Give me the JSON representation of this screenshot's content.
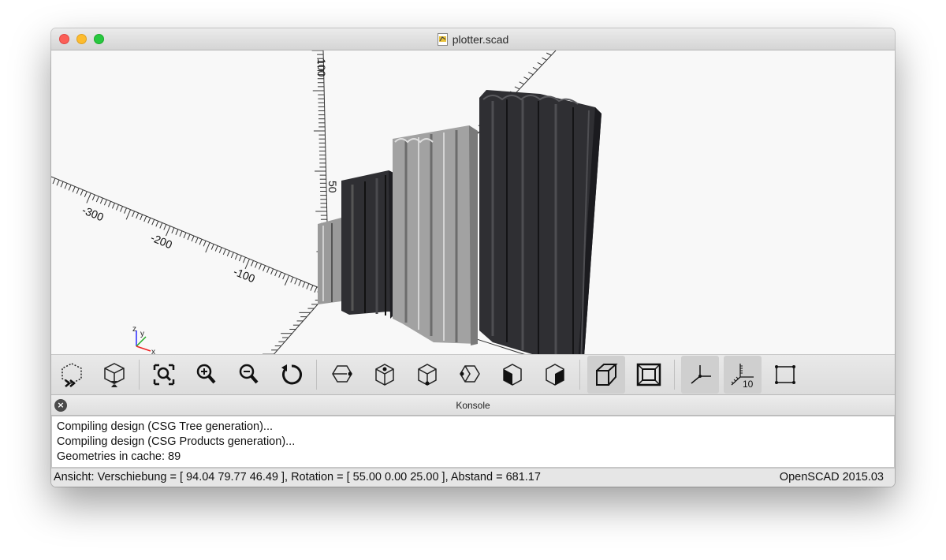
{
  "window": {
    "title": "plotter.scad"
  },
  "viewport": {
    "axis_labels": {
      "neg_300": "-300",
      "neg_200": "-200",
      "neg_100": "-100",
      "z_50": "50",
      "z_100": "100"
    },
    "gizmo": {
      "z": "z",
      "y": "y",
      "x": "x"
    }
  },
  "toolbar": {
    "buttons": [
      {
        "name": "preview",
        "icon": "preview-icon"
      },
      {
        "name": "render",
        "icon": "render-icon"
      },
      {
        "name": "view-all",
        "icon": "zoom-fit-icon"
      },
      {
        "name": "zoom-in",
        "icon": "zoom-in-icon"
      },
      {
        "name": "zoom-out",
        "icon": "zoom-out-icon"
      },
      {
        "name": "reset-view",
        "icon": "reset-view-icon"
      },
      {
        "name": "view-right",
        "icon": "view-right-icon"
      },
      {
        "name": "view-top",
        "icon": "view-top-icon"
      },
      {
        "name": "view-bottom",
        "icon": "view-bottom-icon"
      },
      {
        "name": "view-left",
        "icon": "view-left-icon"
      },
      {
        "name": "view-front",
        "icon": "view-front-icon"
      },
      {
        "name": "view-back",
        "icon": "view-back-icon"
      },
      {
        "name": "perspective",
        "icon": "perspective-icon",
        "active": true
      },
      {
        "name": "orthogonal",
        "icon": "orthogonal-icon"
      },
      {
        "name": "show-axes",
        "icon": "axes-icon",
        "active": true
      },
      {
        "name": "show-scale-markers",
        "icon": "scale-markers-icon",
        "active": true,
        "label": "10"
      },
      {
        "name": "show-edges",
        "icon": "edges-icon"
      }
    ]
  },
  "konsole": {
    "title": "Konsole",
    "close_symbol": "×",
    "lines": [
      "Compiling design (CSG Tree generation)...",
      "Compiling design (CSG Products generation)...",
      "Geometries in cache: 89"
    ]
  },
  "status": {
    "left": "Ansicht: Verschiebung = [ 94.04 79.77 46.49 ], Rotation = [ 55.00 0.00 25.00 ], Abstand = 681.17",
    "right": "OpenSCAD 2015.03"
  },
  "colors": {
    "viewport_bg": "#f8f8f8",
    "extrusion_dark": "#2f2f33",
    "extrusion_light": "#a2a2a2"
  }
}
